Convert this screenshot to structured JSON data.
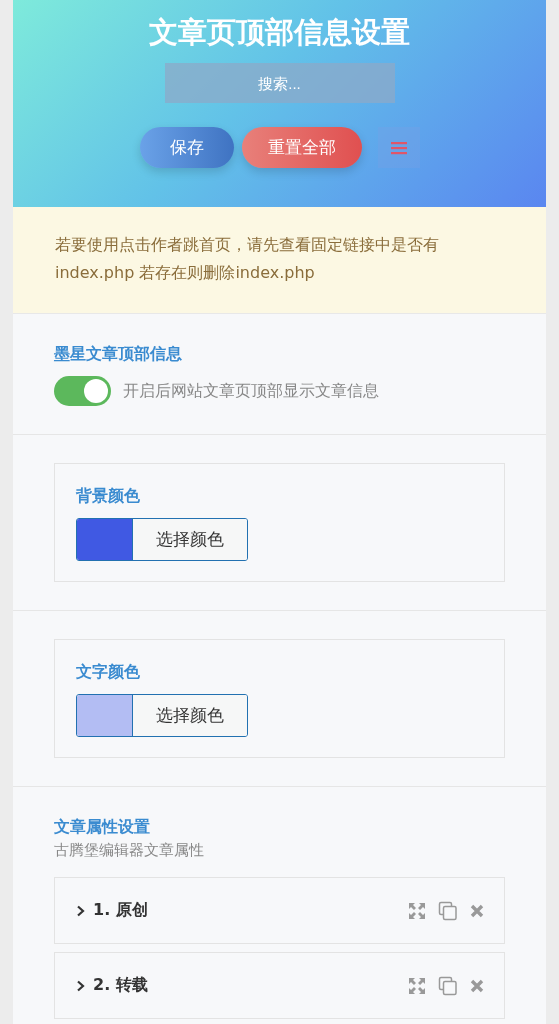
{
  "header": {
    "title": "文章页顶部信息设置",
    "search": {
      "placeholder": "搜索..."
    },
    "buttons": [
      {
        "kind": "save",
        "label": "保存"
      },
      {
        "kind": "reset",
        "label": "重置全部"
      },
      {
        "kind": "menu"
      }
    ]
  },
  "notice": "若要使用点击作者跳首页，请先查看固定链接中是否有index.php 若存在则删除index.php",
  "sections": [
    {
      "kind": "switch",
      "title": "墨星文章顶部信息",
      "on": true,
      "description": "开启后网站文章页顶部显示文章信息"
    },
    {
      "kind": "color",
      "title": "背景颜色",
      "color": "#4059e3",
      "button": "选择颜色"
    },
    {
      "kind": "color",
      "title": "文字颜色",
      "color": "#b3bdf3",
      "button": "选择颜色"
    },
    {
      "kind": "list",
      "title": "文章属性设置",
      "subtitle": "古腾堡编辑器文章属性",
      "items": [
        {
          "label": "1. 原创",
          "expanded": false
        },
        {
          "label": "2. 转载",
          "expanded": false
        }
      ]
    }
  ]
}
